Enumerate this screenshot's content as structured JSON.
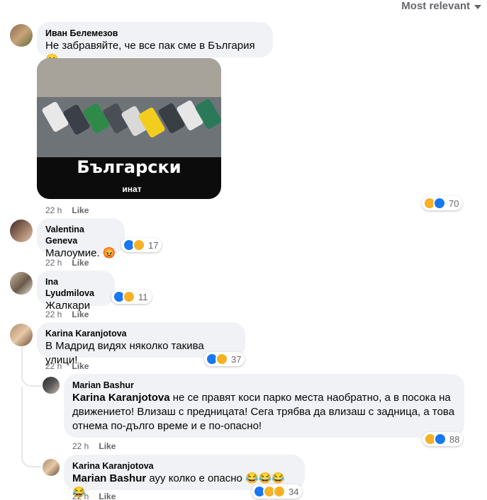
{
  "sort_label": "Most relevant",
  "comments": [
    {
      "author": "Иван Белемезов",
      "text": "Не забравяйте, че все пак сме в България 😬",
      "time": "22 h",
      "like": "Like",
      "reactions_count": "70",
      "image": {
        "caption_big": "Български",
        "caption_small": "инат"
      }
    },
    {
      "author": "Valentina Geneva",
      "text": "Малоумие. 😡",
      "time": "22 h",
      "like": "Like",
      "reactions_count": "17"
    },
    {
      "author": "Ina Lyudmilova",
      "text": "Жалкари",
      "time": "22 h",
      "like": "Like",
      "reactions_count": "11"
    },
    {
      "author": "Karina Karanjotova",
      "text": "В Мадрид видях няколко такива улици!",
      "time": "22 h",
      "like": "Like",
      "reactions_count": "37"
    }
  ],
  "replies": [
    {
      "author": "Marian Bashur",
      "mention": "Karina Karanjotova",
      "text": " не се правят коси парко места наобратно, а в посока на движението! Влизаш с предницата! Сега трябва да влизаш с задница, а това отнема по-дълго време и е по-опасно!",
      "time": "22 h",
      "like": "Like",
      "reactions_count": "88"
    },
    {
      "author": "Karina Karanjotova",
      "mention": "Marian Bashur",
      "text": " ауу колко е опасно 😂😂😂😂",
      "time": "22 h",
      "like": "Like",
      "reactions_count": "34"
    }
  ],
  "colors": {
    "bubble": "#f0f2f5",
    "meta": "#65676b",
    "like_blue": "#1877f2",
    "haha_yellow": "#f7b125"
  }
}
